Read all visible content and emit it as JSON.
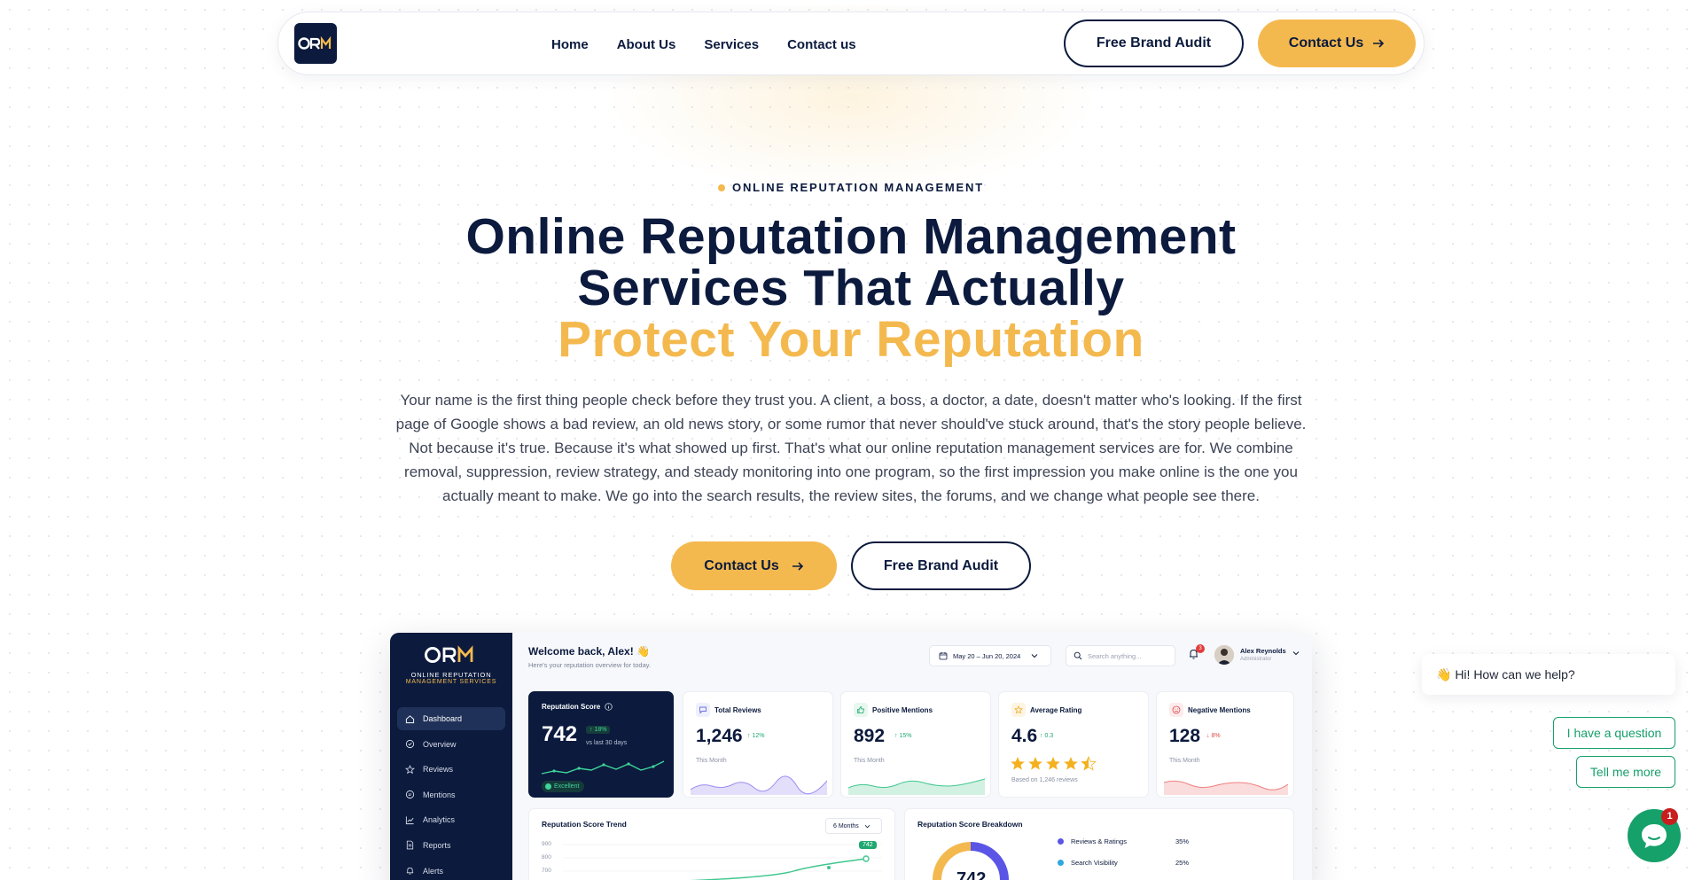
{
  "nav": {
    "logo_text": "ORM",
    "links": [
      "Home",
      "About Us",
      "Services",
      "Contact us"
    ],
    "audit_label": "Free Brand Audit",
    "contact_label": "Contact Us"
  },
  "hero": {
    "eyebrow": "ONLINE REPUTATION MANAGEMENT",
    "title_line1": "Online Reputation Management",
    "title_line2": "Services That Actually",
    "title_line3": "Protect Your Reputation",
    "description": "Your name is the first thing people check before they trust you. A client, a boss, a doctor, a date, doesn't matter who's looking. If the first page of Google shows a bad review, an old news story, or some rumor that never should've stuck around, that's the story people believe. Not because it's true. Because it's what showed up first. That's what our online reputation management services are for. We combine removal, suppression, review strategy, and steady monitoring into one program, so the first impression you make online is the one you actually meant to make. We go into the search results, the review sites, the forums, and we change what people see there.",
    "contact_label": "Contact Us",
    "audit_label": "Free Brand Audit"
  },
  "dashboard": {
    "brand": "ORM",
    "brand_sub1": "ONLINE REPUTATION",
    "brand_sub2": "MANAGEMENT SERVICES",
    "menu": [
      "Dashboard",
      "Overview",
      "Reviews",
      "Mentions",
      "Analytics",
      "Reports",
      "Alerts"
    ],
    "welcome": "Welcome back, Alex! 👋",
    "welcome_sub": "Here's your reputation overview for today.",
    "date_range": "May 20 – Jun 20, 2024",
    "search_placeholder": "Search anything...",
    "notif_count": "3",
    "user_name": "Alex Reynolds",
    "user_role": "Administrator",
    "score_card": {
      "title": "Reputation Score",
      "value": "742",
      "delta": "18%",
      "delta_sub": "vs last 30 days",
      "badge": "Excellent"
    },
    "cards": [
      {
        "title": "Total Reviews",
        "value": "1,246",
        "delta": "12%",
        "foot": "This Month"
      },
      {
        "title": "Positive Mentions",
        "value": "892",
        "delta": "15%",
        "foot": "This Month"
      },
      {
        "title": "Average Rating",
        "value": "4.6",
        "delta": "0.3",
        "foot": "Based on 1,246 reviews"
      },
      {
        "title": "Negative Mentions",
        "value": "128",
        "delta": "8%",
        "foot": "This Month"
      }
    ],
    "trend": {
      "title": "Reputation Score Trend",
      "range": "6 Months",
      "ticks": [
        "900",
        "800",
        "700"
      ],
      "last_label": "742"
    },
    "breakdown": {
      "title": "Reputation Score Breakdown",
      "items": [
        {
          "label": "Reviews & Ratings",
          "pct": "35%"
        },
        {
          "label": "Search Visibility",
          "pct": "25%"
        }
      ],
      "center": "742"
    }
  },
  "chat": {
    "greeting": "👋 Hi! How can we help?",
    "option1": "I have a question",
    "option2": "Tell me more",
    "badge": "1"
  },
  "colors": {
    "navy": "#0b1a3d",
    "gold": "#f4b94e",
    "green": "#16a06a"
  }
}
